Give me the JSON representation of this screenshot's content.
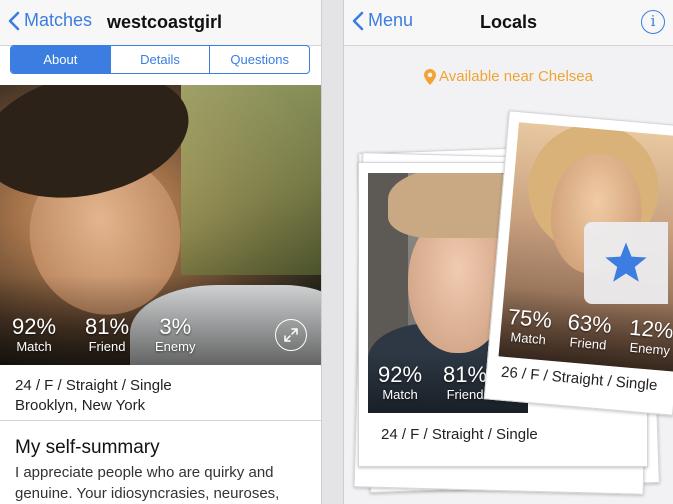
{
  "left": {
    "nav": {
      "back_label": "Matches",
      "title": "westcoastgirl"
    },
    "tabs": [
      {
        "label": "About",
        "active": true
      },
      {
        "label": "Details",
        "active": false
      },
      {
        "label": "Questions",
        "active": false
      }
    ],
    "stats": [
      {
        "value": "92%",
        "label": "Match"
      },
      {
        "value": "81%",
        "label": "Friend"
      },
      {
        "value": "3%",
        "label": "Enemy"
      }
    ],
    "basics": "24 / F / Straight / Single",
    "location": "Brooklyn, New York",
    "section_title": "My self-summary",
    "summary": "I appreciate people who are quirky and genuine. Your idiosyncrasies, neuroses,"
  },
  "right": {
    "nav": {
      "back_label": "Menu",
      "title": "Locals",
      "info_icon": "i"
    },
    "location_label": "Available near Chelsea",
    "front_card": {
      "stats": [
        {
          "value": "92%",
          "label": "Match"
        },
        {
          "value": "81%",
          "label": "Friend"
        }
      ],
      "basics": "24 / F / Straight / Single"
    },
    "back_card": {
      "stats": [
        {
          "value": "75%",
          "label": "Match"
        },
        {
          "value": "63%",
          "label": "Friend"
        },
        {
          "value": "12%",
          "label": "Enemy"
        }
      ],
      "basics": "26 / F / Straight / Single"
    }
  },
  "colors": {
    "accent": "#3b7de0",
    "location": "#f0a434"
  },
  "icons": [
    "chevron-left-icon",
    "expand-icon",
    "location-pin-icon",
    "star-icon",
    "info-icon"
  ]
}
